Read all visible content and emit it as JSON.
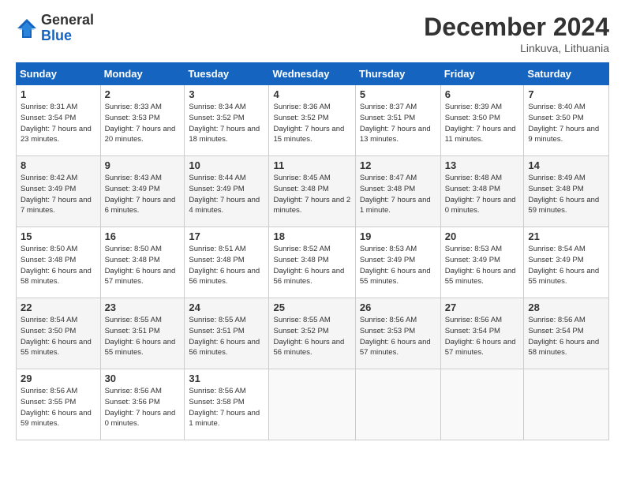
{
  "header": {
    "logo_general": "General",
    "logo_blue": "Blue",
    "month_title": "December 2024",
    "location": "Linkuva, Lithuania"
  },
  "days_of_week": [
    "Sunday",
    "Monday",
    "Tuesday",
    "Wednesday",
    "Thursday",
    "Friday",
    "Saturday"
  ],
  "weeks": [
    [
      {
        "day": "1",
        "sunrise": "Sunrise: 8:31 AM",
        "sunset": "Sunset: 3:54 PM",
        "daylight": "Daylight: 7 hours and 23 minutes."
      },
      {
        "day": "2",
        "sunrise": "Sunrise: 8:33 AM",
        "sunset": "Sunset: 3:53 PM",
        "daylight": "Daylight: 7 hours and 20 minutes."
      },
      {
        "day": "3",
        "sunrise": "Sunrise: 8:34 AM",
        "sunset": "Sunset: 3:52 PM",
        "daylight": "Daylight: 7 hours and 18 minutes."
      },
      {
        "day": "4",
        "sunrise": "Sunrise: 8:36 AM",
        "sunset": "Sunset: 3:52 PM",
        "daylight": "Daylight: 7 hours and 15 minutes."
      },
      {
        "day": "5",
        "sunrise": "Sunrise: 8:37 AM",
        "sunset": "Sunset: 3:51 PM",
        "daylight": "Daylight: 7 hours and 13 minutes."
      },
      {
        "day": "6",
        "sunrise": "Sunrise: 8:39 AM",
        "sunset": "Sunset: 3:50 PM",
        "daylight": "Daylight: 7 hours and 11 minutes."
      },
      {
        "day": "7",
        "sunrise": "Sunrise: 8:40 AM",
        "sunset": "Sunset: 3:50 PM",
        "daylight": "Daylight: 7 hours and 9 minutes."
      }
    ],
    [
      {
        "day": "8",
        "sunrise": "Sunrise: 8:42 AM",
        "sunset": "Sunset: 3:49 PM",
        "daylight": "Daylight: 7 hours and 7 minutes."
      },
      {
        "day": "9",
        "sunrise": "Sunrise: 8:43 AM",
        "sunset": "Sunset: 3:49 PM",
        "daylight": "Daylight: 7 hours and 6 minutes."
      },
      {
        "day": "10",
        "sunrise": "Sunrise: 8:44 AM",
        "sunset": "Sunset: 3:49 PM",
        "daylight": "Daylight: 7 hours and 4 minutes."
      },
      {
        "day": "11",
        "sunrise": "Sunrise: 8:45 AM",
        "sunset": "Sunset: 3:48 PM",
        "daylight": "Daylight: 7 hours and 2 minutes."
      },
      {
        "day": "12",
        "sunrise": "Sunrise: 8:47 AM",
        "sunset": "Sunset: 3:48 PM",
        "daylight": "Daylight: 7 hours and 1 minute."
      },
      {
        "day": "13",
        "sunrise": "Sunrise: 8:48 AM",
        "sunset": "Sunset: 3:48 PM",
        "daylight": "Daylight: 7 hours and 0 minutes."
      },
      {
        "day": "14",
        "sunrise": "Sunrise: 8:49 AM",
        "sunset": "Sunset: 3:48 PM",
        "daylight": "Daylight: 6 hours and 59 minutes."
      }
    ],
    [
      {
        "day": "15",
        "sunrise": "Sunrise: 8:50 AM",
        "sunset": "Sunset: 3:48 PM",
        "daylight": "Daylight: 6 hours and 58 minutes."
      },
      {
        "day": "16",
        "sunrise": "Sunrise: 8:50 AM",
        "sunset": "Sunset: 3:48 PM",
        "daylight": "Daylight: 6 hours and 57 minutes."
      },
      {
        "day": "17",
        "sunrise": "Sunrise: 8:51 AM",
        "sunset": "Sunset: 3:48 PM",
        "daylight": "Daylight: 6 hours and 56 minutes."
      },
      {
        "day": "18",
        "sunrise": "Sunrise: 8:52 AM",
        "sunset": "Sunset: 3:48 PM",
        "daylight": "Daylight: 6 hours and 56 minutes."
      },
      {
        "day": "19",
        "sunrise": "Sunrise: 8:53 AM",
        "sunset": "Sunset: 3:49 PM",
        "daylight": "Daylight: 6 hours and 55 minutes."
      },
      {
        "day": "20",
        "sunrise": "Sunrise: 8:53 AM",
        "sunset": "Sunset: 3:49 PM",
        "daylight": "Daylight: 6 hours and 55 minutes."
      },
      {
        "day": "21",
        "sunrise": "Sunrise: 8:54 AM",
        "sunset": "Sunset: 3:49 PM",
        "daylight": "Daylight: 6 hours and 55 minutes."
      }
    ],
    [
      {
        "day": "22",
        "sunrise": "Sunrise: 8:54 AM",
        "sunset": "Sunset: 3:50 PM",
        "daylight": "Daylight: 6 hours and 55 minutes."
      },
      {
        "day": "23",
        "sunrise": "Sunrise: 8:55 AM",
        "sunset": "Sunset: 3:51 PM",
        "daylight": "Daylight: 6 hours and 55 minutes."
      },
      {
        "day": "24",
        "sunrise": "Sunrise: 8:55 AM",
        "sunset": "Sunset: 3:51 PM",
        "daylight": "Daylight: 6 hours and 56 minutes."
      },
      {
        "day": "25",
        "sunrise": "Sunrise: 8:55 AM",
        "sunset": "Sunset: 3:52 PM",
        "daylight": "Daylight: 6 hours and 56 minutes."
      },
      {
        "day": "26",
        "sunrise": "Sunrise: 8:56 AM",
        "sunset": "Sunset: 3:53 PM",
        "daylight": "Daylight: 6 hours and 57 minutes."
      },
      {
        "day": "27",
        "sunrise": "Sunrise: 8:56 AM",
        "sunset": "Sunset: 3:54 PM",
        "daylight": "Daylight: 6 hours and 57 minutes."
      },
      {
        "day": "28",
        "sunrise": "Sunrise: 8:56 AM",
        "sunset": "Sunset: 3:54 PM",
        "daylight": "Daylight: 6 hours and 58 minutes."
      }
    ],
    [
      {
        "day": "29",
        "sunrise": "Sunrise: 8:56 AM",
        "sunset": "Sunset: 3:55 PM",
        "daylight": "Daylight: 6 hours and 59 minutes."
      },
      {
        "day": "30",
        "sunrise": "Sunrise: 8:56 AM",
        "sunset": "Sunset: 3:56 PM",
        "daylight": "Daylight: 7 hours and 0 minutes."
      },
      {
        "day": "31",
        "sunrise": "Sunrise: 8:56 AM",
        "sunset": "Sunset: 3:58 PM",
        "daylight": "Daylight: 7 hours and 1 minute."
      },
      null,
      null,
      null,
      null
    ]
  ]
}
